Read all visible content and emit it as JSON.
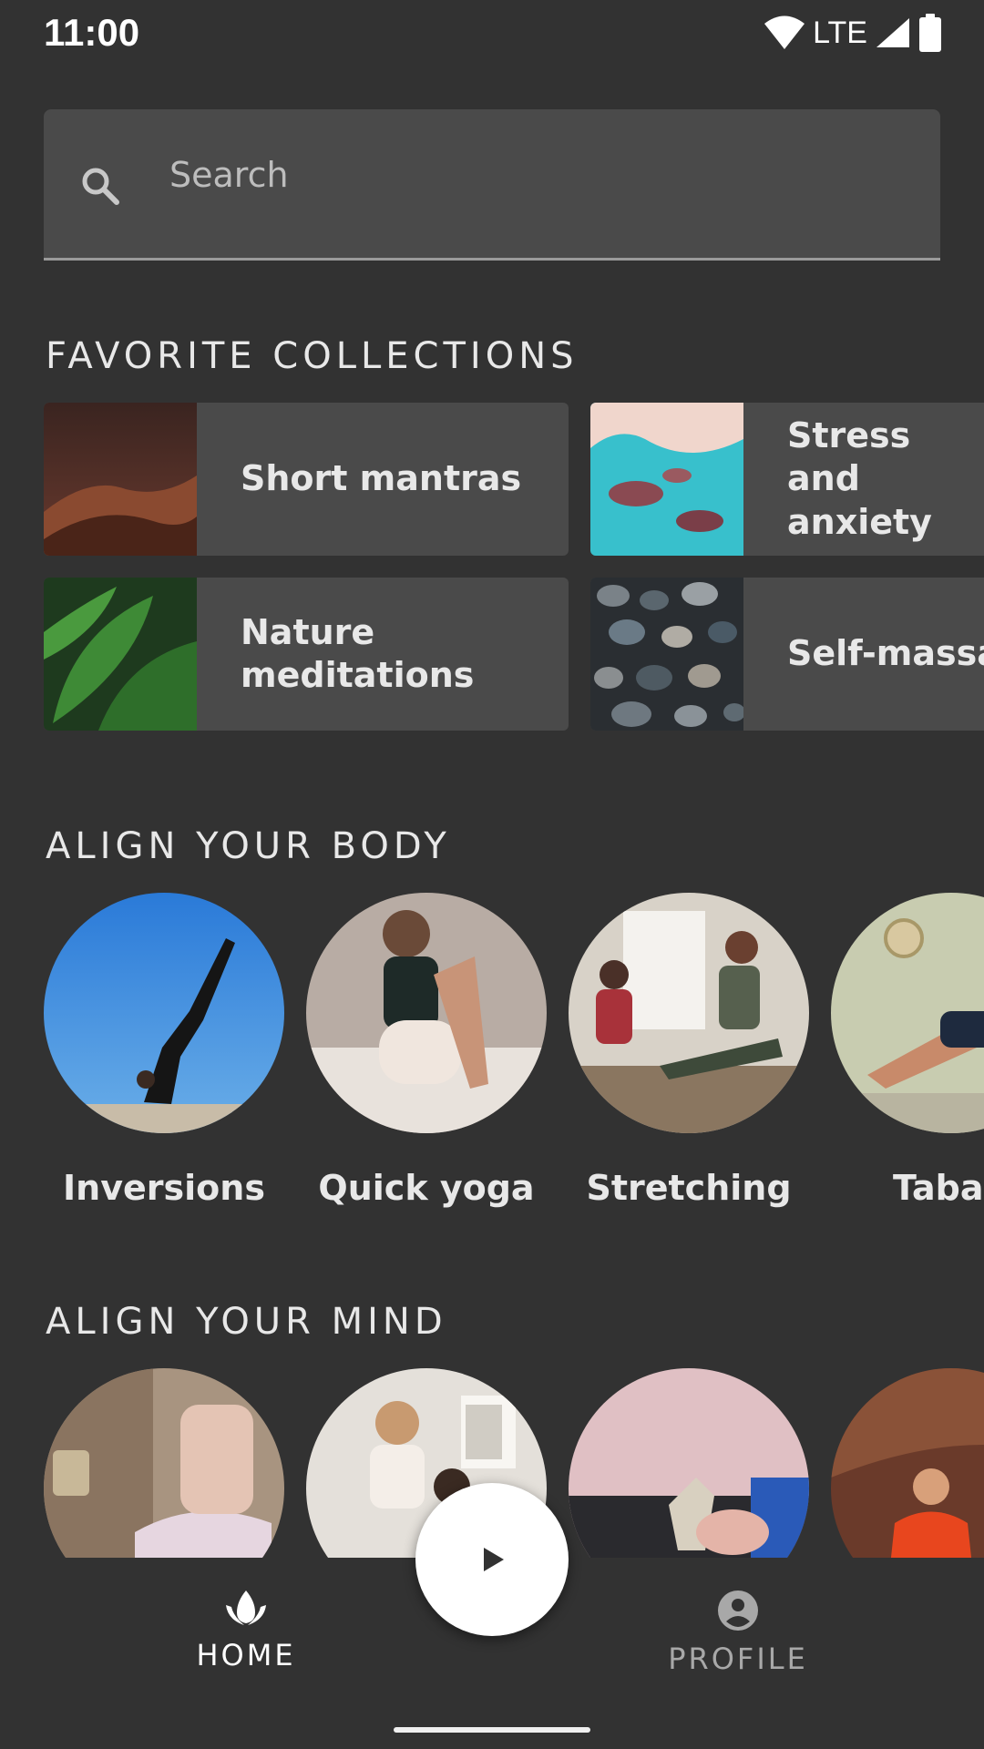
{
  "status_bar": {
    "time": "11:00",
    "network": "LTE"
  },
  "search": {
    "placeholder": "Search"
  },
  "favorite_collections": {
    "title": "FAVORITE COLLECTIONS",
    "items": [
      {
        "label": "Short mantras"
      },
      {
        "label": "Stress and anxiety"
      },
      {
        "label": "Nature meditations"
      },
      {
        "label": "Self-massage"
      }
    ]
  },
  "align_body": {
    "title": "ALIGN YOUR BODY",
    "items": [
      {
        "label": "Inversions"
      },
      {
        "label": "Quick yoga"
      },
      {
        "label": "Stretching"
      },
      {
        "label": "Tabata"
      }
    ]
  },
  "align_mind": {
    "title": "ALIGN YOUR MIND"
  },
  "bottom_nav": {
    "home_label": "HOME",
    "profile_label": "PROFILE",
    "active": "home"
  },
  "colors": {
    "background": "#323232",
    "surface": "#4a4a4a",
    "text": "#e8e8e8",
    "inactive": "#a8a8a8",
    "fab": "#ffffff"
  },
  "icons": {
    "wifi": "wifi-icon",
    "signal": "signal-icon",
    "battery": "battery-icon",
    "search": "search-icon",
    "home": "lotus-icon",
    "profile": "account-circle-icon",
    "play": "play-icon"
  }
}
